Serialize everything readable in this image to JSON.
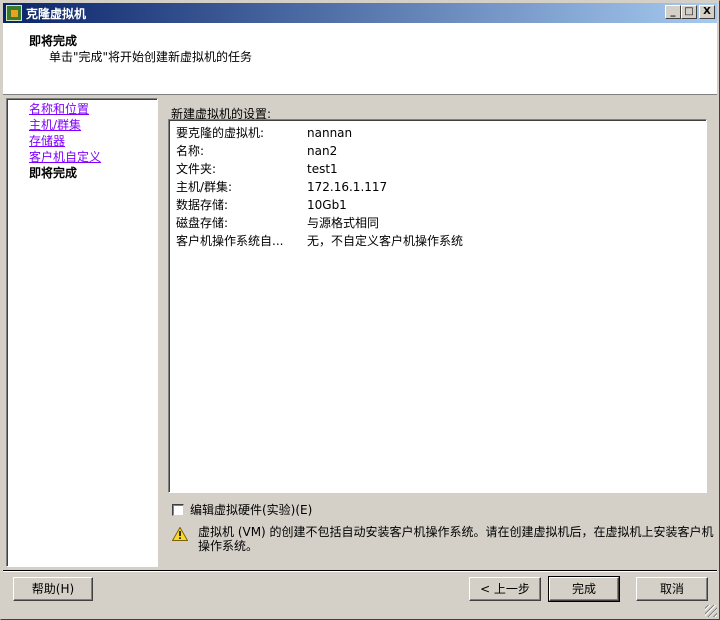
{
  "window": {
    "title": "克隆虚拟机",
    "minimize": "_",
    "maximize": "□",
    "close": "X"
  },
  "header": {
    "title": "即将完成",
    "subtitle": "单击\"完成\"将开始创建新虚拟机的任务"
  },
  "nav": {
    "links": [
      "名称和位置",
      "主机/群集",
      "存储器",
      "客户机自定义"
    ],
    "current": "即将完成"
  },
  "settings": {
    "label": "新建虚拟机的设置:",
    "rows": [
      {
        "k": "要克隆的虚拟机:",
        "v": "nannan"
      },
      {
        "k": "名称:",
        "v": "nan2"
      },
      {
        "k": "文件夹:",
        "v": "test1"
      },
      {
        "k": "主机/群集:",
        "v": "172.16.1.117"
      },
      {
        "k": "数据存储:",
        "v": "10Gb1"
      },
      {
        "k": "磁盘存储:",
        "v": "与源格式相同"
      },
      {
        "k": "客户机操作系统自...",
        "v": "无，不自定义客户机操作系统"
      }
    ]
  },
  "edit_hw": {
    "label": "编辑虚拟硬件(实验)(E)",
    "checked": false
  },
  "warning": "虚拟机 (VM) 的创建不包括自动安装客户机操作系统。请在创建虚拟机后，在虚拟机上安装客户机操作系统。",
  "buttons": {
    "help": "帮助(H)",
    "back": "< 上一步",
    "finish": "完成",
    "cancel": "取消"
  }
}
